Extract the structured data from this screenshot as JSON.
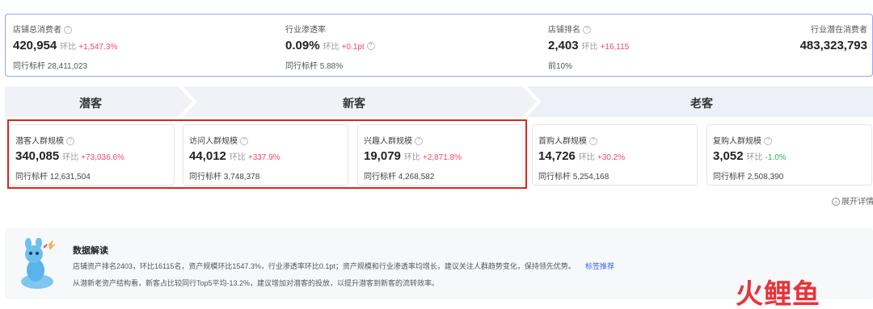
{
  "summary": {
    "total_consumers": {
      "label": "店铺总消费者",
      "value": "420,954",
      "chg_label": "环比",
      "chg": "+1,547.3%",
      "sub": "同行标杆  28,411,023"
    },
    "penetration": {
      "label": "行业渗透率",
      "value": "0.09%",
      "chg_label": "环比",
      "chg": "+0.1pt",
      "sub": "同行标杆  5.88%"
    },
    "rank": {
      "label": "店铺排名",
      "value": "2,403",
      "chg_label": "环比",
      "chg": "+16,115",
      "sub": "前10%"
    },
    "potential": {
      "label": "行业潜在消费者",
      "value": "483,323,793"
    }
  },
  "banner": {
    "potential": "潜客",
    "new": "新客",
    "old": "老客"
  },
  "cards": [
    {
      "label": "潜客人群规模",
      "value": "340,085",
      "chg_label": "环比",
      "chg": "+73,036.6%",
      "sub": "同行标杆 12,631,504"
    },
    {
      "label": "访问人群规模",
      "value": "44,012",
      "chg_label": "环比",
      "chg": "+337.9%",
      "sub": "同行标杆 3,748,378"
    },
    {
      "label": "兴趣人群规模",
      "value": "19,079",
      "chg_label": "环比",
      "chg": "+2,871.8%",
      "sub": "同行标杆 4,268,582"
    },
    {
      "label": "首购人群规模",
      "value": "14,726",
      "chg_label": "环比",
      "chg": "+30.2%",
      "sub": "同行标杆 5,254,168"
    },
    {
      "label": "复购人群规模",
      "value": "3,052",
      "chg_label": "环比",
      "chg": "-1.0%",
      "sub": "同行标杆 2,508,390"
    }
  ],
  "expand_label": "展开详情",
  "insight": {
    "title": "数据解读",
    "line1": "店铺资产排名2403，环比16115名，资产规模环比1547.3%，行业渗透率环比0.1pt；资产规模和行业渗透率均增长，建议关注人群趋势变化，保持领先优势。",
    "link": "标签推荐",
    "line2": "从潜新老资产结构看，新客占比较同行Top5平均-13.2%，建议增加对潜客的投放，以提升潜客到新客的流转效率。"
  },
  "logo_text": "火鲤鱼",
  "colors": {
    "accent": "#3a63f5",
    "up": "#f04864",
    "down": "#2fb45c",
    "highlight": "#d9281c"
  }
}
